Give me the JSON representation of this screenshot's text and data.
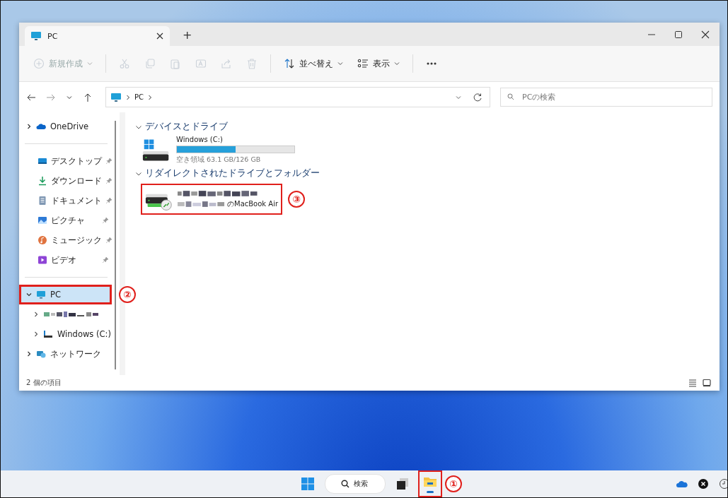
{
  "window": {
    "tab_title": "PC",
    "new_tab": "+"
  },
  "toolbar": [
    {
      "kind": "new",
      "label": "新規作成",
      "disabled": true
    },
    {
      "kind": "cut",
      "disabled": true
    },
    {
      "kind": "copy",
      "disabled": true
    },
    {
      "kind": "paste",
      "disabled": true
    },
    {
      "kind": "rename",
      "disabled": true
    },
    {
      "kind": "share",
      "disabled": true
    },
    {
      "kind": "delete",
      "disabled": true
    },
    {
      "kind": "sort",
      "label": "並べ替え",
      "disabled": false
    },
    {
      "kind": "view",
      "label": "表示",
      "disabled": false
    },
    {
      "kind": "more",
      "disabled": false
    }
  ],
  "address": {
    "crumbs": [
      "PC"
    ]
  },
  "search": {
    "placeholder": "PCの検索"
  },
  "sidebar": [
    {
      "kind": "onedrive",
      "label": "OneDrive",
      "expanded": false
    },
    {
      "kind": "desktop",
      "label": "デスクトップ",
      "pinned": true
    },
    {
      "kind": "downloads",
      "label": "ダウンロード",
      "pinned": true
    },
    {
      "kind": "documents",
      "label": "ドキュメント",
      "pinned": true
    },
    {
      "kind": "pictures",
      "label": "ピクチャ",
      "pinned": true
    },
    {
      "kind": "music",
      "label": "ミュージック",
      "pinned": true
    },
    {
      "kind": "videos",
      "label": "ビデオ",
      "pinned": true
    },
    {
      "kind": "pc",
      "label": "PC",
      "expanded": true,
      "selected": true,
      "callout": "②",
      "children": [
        {
          "kind": "obscured",
          "expanded": false
        },
        {
          "kind": "drive",
          "label": "Windows (C:)",
          "expanded": false
        }
      ]
    },
    {
      "kind": "network",
      "label": "ネットワーク",
      "expanded": false
    }
  ],
  "sections": [
    {
      "title": "デバイスとドライブ",
      "items": [
        {
          "kind": "drive",
          "name": "Windows (C:)",
          "level": 0.5,
          "free": "空き領域 63.1 GB/126 GB"
        }
      ]
    },
    {
      "title": "リダイレクトされたドライブとフォルダー",
      "items": [
        {
          "kind": "redirect",
          "name": "のMacBook Air",
          "callout": "③"
        }
      ]
    }
  ],
  "status_bar": {
    "count": "2 個の項目"
  },
  "taskbar": {
    "search": "検索",
    "explorer_callout": "①"
  }
}
